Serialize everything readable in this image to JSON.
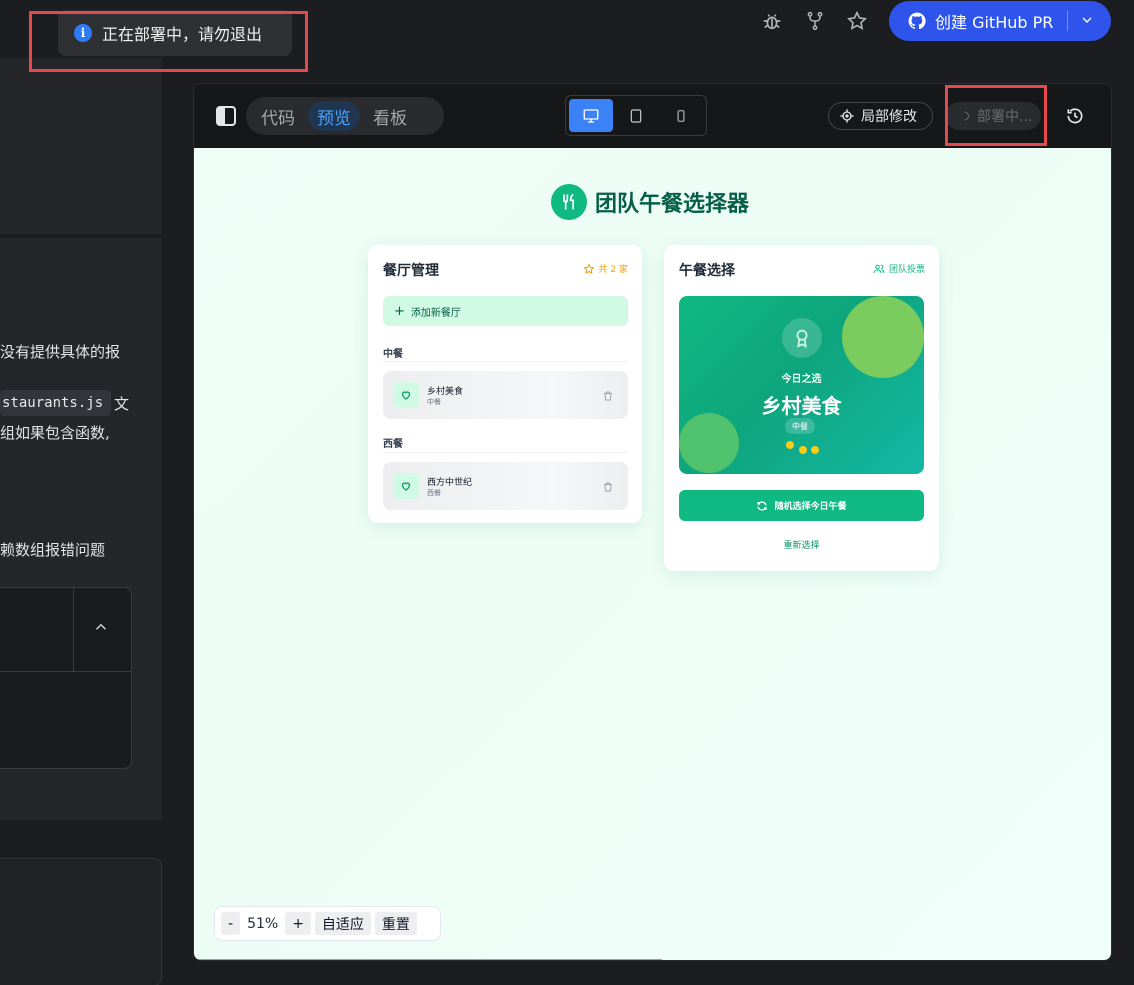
{
  "toast": {
    "message": "正在部署中，请勿退出",
    "icon": "info-icon"
  },
  "header": {
    "icons": [
      "bug-icon",
      "fork-icon",
      "star-icon"
    ],
    "github_button": {
      "label": "创建 GitHub PR",
      "icon": "github-icon"
    }
  },
  "left_panel": {
    "text_1": "没有提供具体的报",
    "code_chip": "staurants.js",
    "text_2": "文",
    "text_3": "组如果包含函数,",
    "text_4": "赖数组报错问题"
  },
  "preview_toolbar": {
    "tabs": [
      "代码",
      "预览",
      "看板"
    ],
    "active_tab": "预览",
    "local_edit_label": "局部修改",
    "deploy_label": "部署中..."
  },
  "app": {
    "title": "团队午餐选择器",
    "restaurants_card": {
      "title": "餐厅管理",
      "count_label": "共 2 家",
      "add_label": "添加新餐厅",
      "categories": [
        {
          "name": "中餐",
          "items": [
            {
              "name": "乡村美食",
              "category": "中餐"
            }
          ]
        },
        {
          "name": "西餐",
          "items": [
            {
              "name": "西方中世纪",
              "category": "西餐"
            }
          ]
        }
      ]
    },
    "lunch_card": {
      "title": "午餐选择",
      "vote_label": "团队投票",
      "today_label": "今日之选",
      "pick_name": "乡村美食",
      "pick_category": "中餐",
      "random_button": "随机选择今日午餐",
      "reselect": "重新选择"
    }
  },
  "zoom": {
    "minus": "-",
    "value": "51%",
    "plus": "+",
    "fit": "自适应",
    "reset": "重置"
  },
  "colors": {
    "accent_green": "#10b981",
    "primary_blue": "#2f54eb",
    "highlight_red": "#e5484d"
  }
}
